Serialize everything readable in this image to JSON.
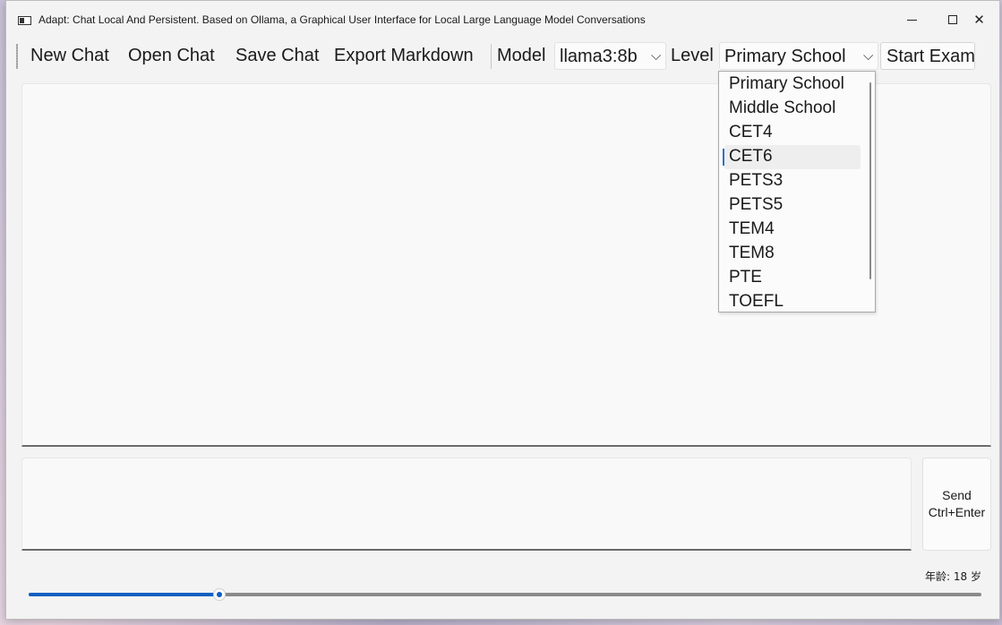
{
  "window": {
    "title": "Adapt: Chat Local And Persistent. Based on Ollama, a Graphical User Interface for Local Large Language Model Conversations",
    "controls": {
      "minimize": "—",
      "maximize": "☐",
      "close": "✕"
    }
  },
  "toolbar": {
    "new_chat": "New Chat",
    "open_chat": "Open Chat",
    "save_chat": "Save Chat",
    "export_markdown": "Export Markdown",
    "model_label": "Model",
    "model_value": "llama3:8b",
    "level_label": "Level",
    "level_value": "Primary School",
    "start_exam": "Start Exam",
    "chevron": "⌵"
  },
  "level_options": [
    "Primary School",
    "Middle School",
    "CET4",
    "CET6",
    "PETS3",
    "PETS5",
    "TEM4",
    "TEM8",
    "PTE",
    "TOEFL"
  ],
  "level_hovered": "CET6",
  "send": {
    "line1": "Send",
    "line2": "Ctrl+Enter"
  },
  "age": {
    "text": "年龄: 18 岁",
    "value": 18,
    "slider_fraction": 0.2
  },
  "colors": {
    "accent": "#0f5fc0",
    "hover_marker": "#2d73c9"
  },
  "icons": {
    "app": "app-window-icon",
    "minimize": "minimize-icon",
    "maximize": "maximize-icon",
    "close": "close-icon",
    "dropdown": "chevron-down-icon"
  }
}
